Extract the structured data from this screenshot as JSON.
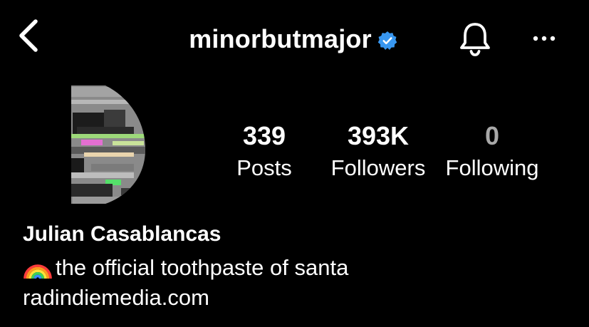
{
  "header": {
    "username": "minorbutmajor",
    "icons": {
      "back": "chevron-left-icon",
      "verified": "verified-badge-icon",
      "notifications": "bell-icon",
      "more": "more-horizontal-icon"
    }
  },
  "stats": {
    "posts": {
      "value": "339",
      "label": "Posts"
    },
    "followers": {
      "value": "393K",
      "label": "Followers"
    },
    "following": {
      "value": "0",
      "label": "Following"
    }
  },
  "profile": {
    "name": "Julian Casablancas",
    "bio_icon": "rainbow-emoji",
    "bio": "the official toothpaste of santa",
    "link": "radindiemedia.com"
  },
  "colors": {
    "background": "#000000",
    "text": "#ffffff",
    "verified_badge": "#3897f0",
    "muted_count": "#a8a8a8"
  }
}
